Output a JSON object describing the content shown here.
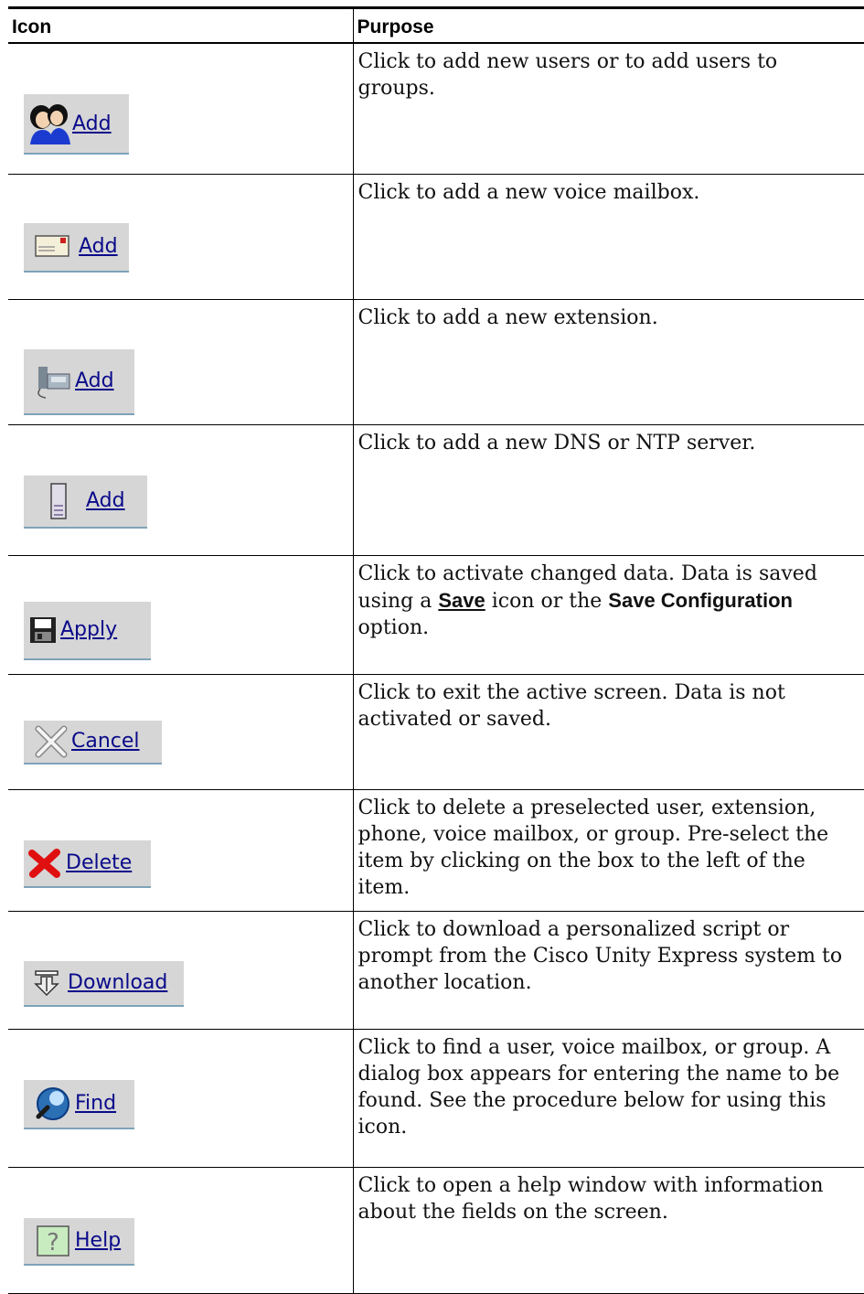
{
  "table": {
    "headers": {
      "icon": "Icon",
      "purpose": "Purpose"
    },
    "rows": [
      {
        "icon_name": "users-icon",
        "label": "Add",
        "text": "Click to add new users or to add users to groups."
      },
      {
        "icon_name": "mailbox-icon",
        "label": "Add",
        "text": "Click to add a new voice mailbox."
      },
      {
        "icon_name": "phone-icon",
        "label": "Add",
        "text": "Click to add a new extension."
      },
      {
        "icon_name": "server-icon",
        "label": "Add",
        "text": "Click to add a new DNS or NTP server."
      },
      {
        "icon_name": "floppy-disk-icon",
        "label": "Apply",
        "text_a": "Click to activate changed data. Data is saved using a ",
        "text_b": "Save",
        "text_c": " icon or the ",
        "text_d": "Save Configuration",
        "text_e": " option."
      },
      {
        "icon_name": "cancel-x-icon",
        "label": "Cancel",
        "text": "Click to exit the active screen. Data is not activated or saved."
      },
      {
        "icon_name": "delete-x-icon",
        "label": "Delete",
        "text": "Click to delete a preselected user, extension, phone, voice mailbox, or group. Pre-select the item by clicking on the box to the left of the item."
      },
      {
        "icon_name": "download-icon",
        "label": "Download",
        "text": "Click to download a personalized script or prompt from the Cisco Unity Express system to another location."
      },
      {
        "icon_name": "magnifier-icon",
        "label": "Find",
        "text": "Click to find a user, voice mailbox, or group. A dialog box appears for entering the name to be found. See the procedure below for using this icon."
      },
      {
        "icon_name": "help-icon",
        "label": "Help",
        "text": "Click to open a help window with information about the fields on the screen."
      }
    ]
  },
  "colors": {
    "button_bg": "#d6d6d6",
    "link_text": "#0a0a8a",
    "delete_red": "#e01010",
    "find_blue": "#2b6fb5"
  }
}
